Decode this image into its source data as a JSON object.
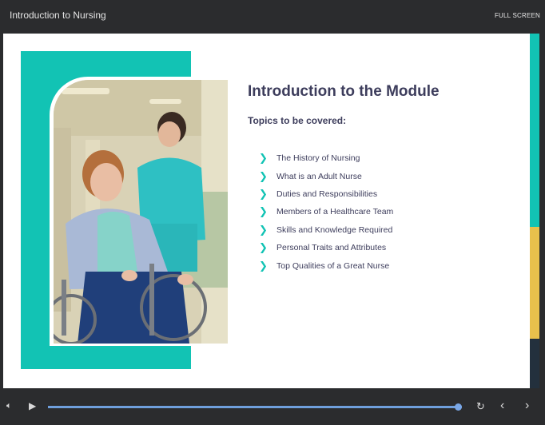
{
  "player": {
    "title": "Introduction to Nursing",
    "fullscreen_label": "FULL SCREEN"
  },
  "slide": {
    "title": "Introduction to the Module",
    "topics_heading": "Topics to be covered:",
    "topics": [
      "The History of Nursing",
      "What is an Adult Nurse",
      "Duties and Responsibilities",
      "Members of a Healthcare Team",
      "Skills and Knowledge Required",
      "Personal Traits and Attributes",
      "Top Qualities of a Great Nurse"
    ],
    "bullet_icon": "chevron-right-icon",
    "photo_icon": "nurse-with-wheelchair-patient-photo"
  },
  "controls": {
    "volume_icon": "speaker-icon",
    "play_icon": "play-icon",
    "replay_icon": "replay-icon",
    "prev_icon": "chevron-left-icon",
    "next_icon": "chevron-right-icon",
    "progress_fraction": 0.99
  },
  "colors": {
    "accent_teal": "#12c3b4",
    "accent_yellow": "#e8c04c",
    "heading_text": "#3d3d5c",
    "chrome_bg": "#2b2c2e"
  }
}
